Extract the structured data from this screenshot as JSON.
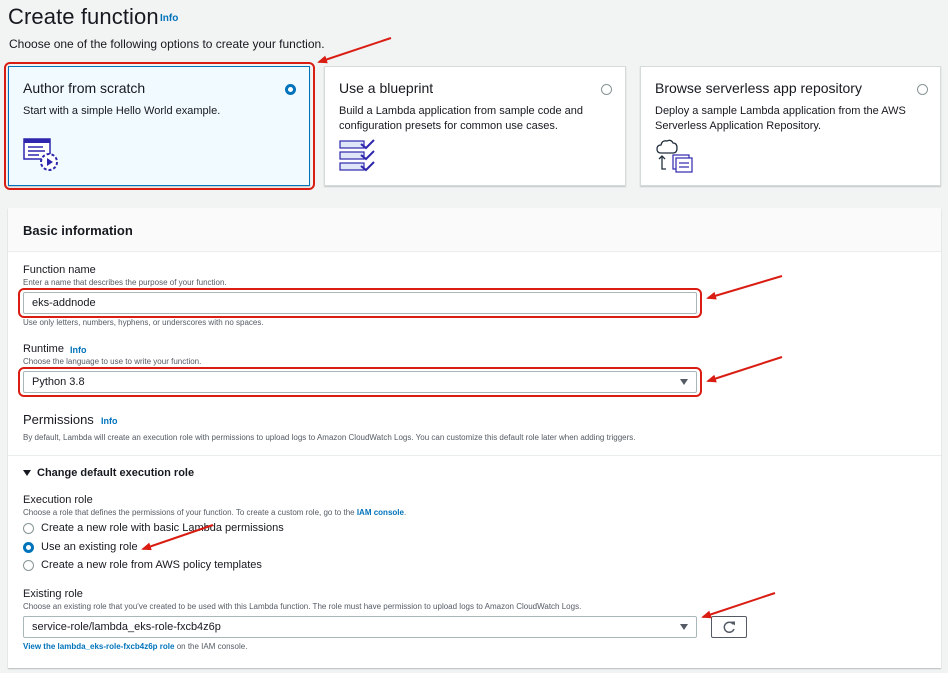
{
  "header": {
    "title": "Create function",
    "info": "Info",
    "subtitle": "Choose one of the following options to create your function."
  },
  "options": [
    {
      "title": "Author from scratch",
      "desc": "Start with a simple Hello World example.",
      "selected": true
    },
    {
      "title": "Use a blueprint",
      "desc": "Build a Lambda application from sample code and configuration presets for common use cases.",
      "selected": false
    },
    {
      "title": "Browse serverless app repository",
      "desc": "Deploy a sample Lambda application from the AWS Serverless Application Repository.",
      "selected": false
    }
  ],
  "basic": {
    "title": "Basic information",
    "function_name": {
      "label": "Function name",
      "hint": "Enter a name that describes the purpose of your function.",
      "value": "eks-addnode",
      "constraint": "Use only letters, numbers, hyphens, or underscores with no spaces."
    },
    "runtime": {
      "label": "Runtime",
      "info": "Info",
      "hint": "Choose the language to use to write your function.",
      "value": "Python 3.8"
    },
    "permissions": {
      "title": "Permissions",
      "info": "Info",
      "desc": "By default, Lambda will create an execution role with permissions to upload logs to Amazon CloudWatch Logs. You can customize this default role later when adding triggers."
    },
    "change_role": "Change default execution role",
    "execution_role": {
      "label": "Execution role",
      "hint_prefix": "Choose a role that defines the permissions of your function. To create a custom role, go to the",
      "hint_link": "IAM console",
      "hint_suffix": ".",
      "choices": [
        {
          "label": "Create a new role with basic Lambda permissions",
          "selected": false
        },
        {
          "label": "Use an existing role",
          "selected": true
        },
        {
          "label": "Create a new role from AWS policy templates",
          "selected": false
        }
      ]
    },
    "existing_role": {
      "label": "Existing role",
      "hint": "Choose an existing role that you've created to be used with this Lambda function. The role must have permission to upload logs to Amazon CloudWatch Logs.",
      "value": "service-role/lambda_eks-role-fxcb4z6p",
      "view_link": "View the lambda_eks-role-fxcb4z6p role",
      "view_suffix": "on the IAM console."
    }
  },
  "colors": {
    "accent": "#0073bb",
    "annotation": "#d91d13",
    "selected_card_bg": "#f1faff"
  },
  "icons": [
    "hello-world-code-icon",
    "blueprint-checklist-icon",
    "serverless-cloud-icon",
    "refresh-icon",
    "caret-down-icon"
  ]
}
